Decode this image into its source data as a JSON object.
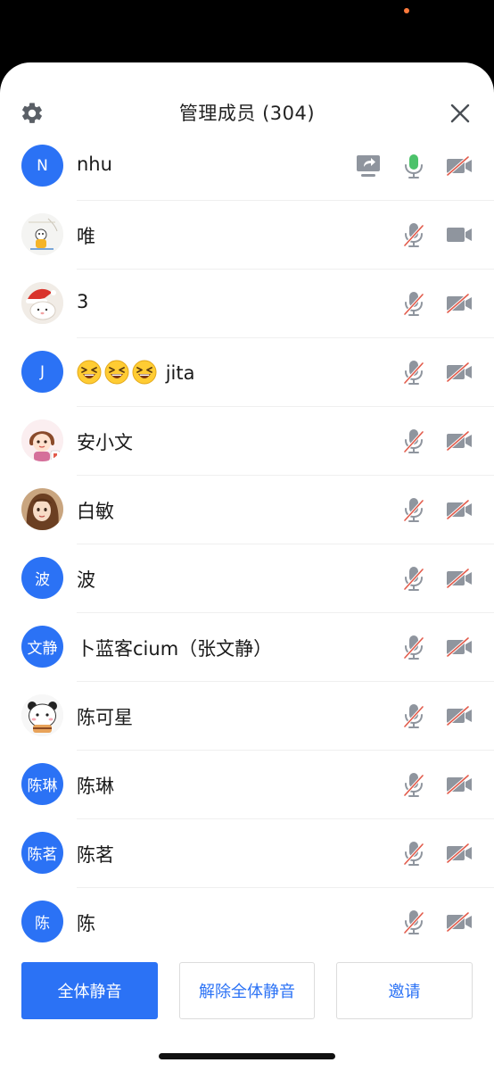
{
  "header": {
    "title": "管理成员 (304)",
    "settings_icon": "gear-icon",
    "close_icon": "close-icon"
  },
  "colors": {
    "accent": "#2b72f5",
    "muted_slash": "#e25b4b",
    "icon_gray": "#8f959e"
  },
  "members": [
    {
      "name": "nhu",
      "avatar_type": "letter",
      "avatar_text": "N",
      "sharing": true,
      "mic_muted": false,
      "mic_active": true,
      "camera_off": true
    },
    {
      "name": "唯",
      "avatar_type": "image",
      "avatar_image": "cartoon-cat-on-swing",
      "sharing": false,
      "mic_muted": true,
      "mic_active": false,
      "camera_off": false
    },
    {
      "name": "3",
      "avatar_type": "image",
      "avatar_image": "santa-hat-cat",
      "sharing": false,
      "mic_muted": true,
      "mic_active": false,
      "camera_off": true
    },
    {
      "name": "jita",
      "name_prefix_emoji": "grinning-squinting-face",
      "name_prefix_emoji_count": 3,
      "avatar_type": "letter",
      "avatar_text": "J",
      "sharing": false,
      "mic_muted": true,
      "mic_active": false,
      "camera_off": true
    },
    {
      "name": "安小文",
      "avatar_type": "image",
      "avatar_image": "cartoon-girl",
      "sharing": false,
      "mic_muted": true,
      "mic_active": false,
      "camera_off": true
    },
    {
      "name": "白敏",
      "avatar_type": "image",
      "avatar_image": "illustrated-woman",
      "sharing": false,
      "mic_muted": true,
      "mic_active": false,
      "camera_off": true
    },
    {
      "name": "波",
      "avatar_type": "letter",
      "avatar_text": "波",
      "sharing": false,
      "mic_muted": true,
      "mic_active": false,
      "camera_off": true
    },
    {
      "name": "卜蓝客cium（张文静）",
      "avatar_type": "letter",
      "avatar_text": "文静",
      "sharing": false,
      "mic_muted": true,
      "mic_active": false,
      "camera_off": true
    },
    {
      "name": "陈可星",
      "avatar_type": "image",
      "avatar_image": "panda-bear-cartoon",
      "sharing": false,
      "mic_muted": true,
      "mic_active": false,
      "camera_off": true
    },
    {
      "name": "陈琳",
      "avatar_type": "letter",
      "avatar_text": "陈琳",
      "sharing": false,
      "mic_muted": true,
      "mic_active": false,
      "camera_off": true
    },
    {
      "name": "陈茗",
      "avatar_type": "letter",
      "avatar_text": "陈茗",
      "sharing": false,
      "mic_muted": true,
      "mic_active": false,
      "camera_off": true
    },
    {
      "name": "陈",
      "avatar_type": "letter",
      "avatar_text": "陈",
      "sharing": false,
      "mic_muted": true,
      "mic_active": false,
      "camera_off": true
    }
  ],
  "actions": {
    "mute_all": "全体静音",
    "unmute_all": "解除全体静音",
    "invite": "邀请"
  }
}
